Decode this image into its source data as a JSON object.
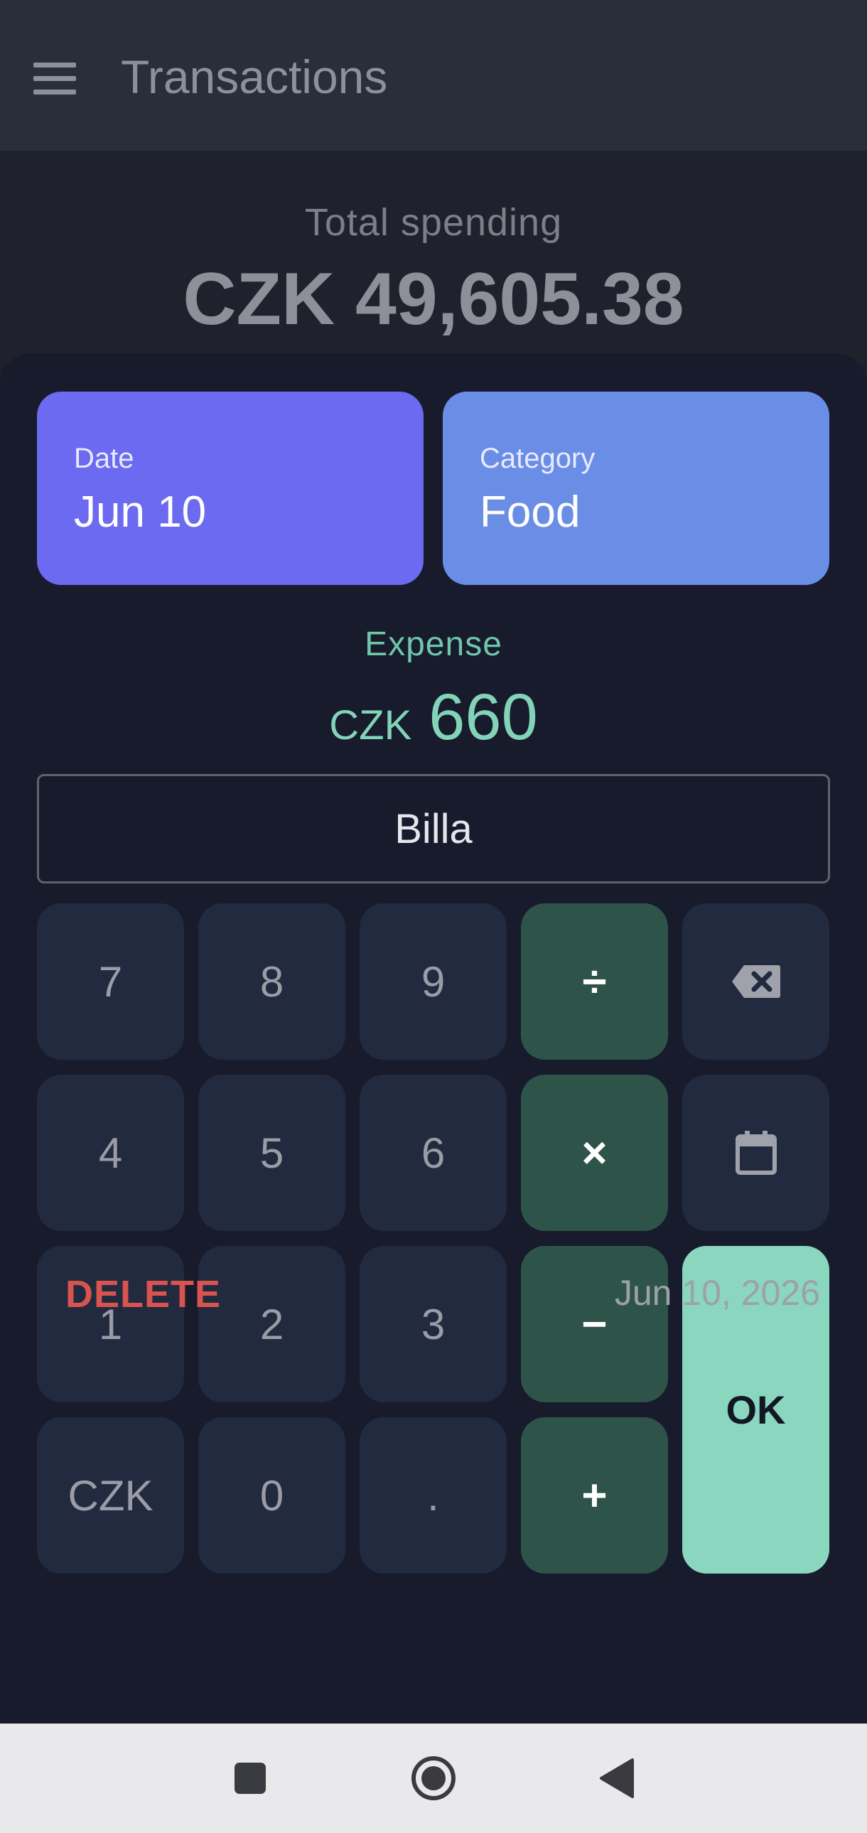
{
  "appbar": {
    "title": "Transactions",
    "menu_icon": "menu-icon"
  },
  "summary": {
    "label": "Total spending",
    "amount": "CZK 49,605.38"
  },
  "sheet": {
    "date_card": {
      "label": "Date",
      "value": "Jun 10"
    },
    "category_card": {
      "label": "Category",
      "value": "Food"
    },
    "type_label": "Expense",
    "amount": {
      "currency": "CZK",
      "value": "660"
    },
    "note": "Billa",
    "keypad": {
      "k7": "7",
      "k8": "8",
      "k9": "9",
      "divide": "÷",
      "backspace_icon": "backspace-icon",
      "k4": "4",
      "k5": "5",
      "k6": "6",
      "multiply": "×",
      "calendar_icon": "calendar-icon",
      "k1": "1",
      "k2": "2",
      "k3": "3",
      "minus": "−",
      "ok": "OK",
      "currency": "CZK",
      "k0": "0",
      "dot": ".",
      "plus": "+"
    },
    "delete_label": "DELETE",
    "date_text": "Jun 10, 2026"
  },
  "colors": {
    "date_card": "#6b6af0",
    "category_card": "#6a8de6",
    "operator_key": "#2e5449",
    "ok_key": "#8ad6bf",
    "expense_accent": "#82d3b8",
    "delete": "#d9534f"
  },
  "navbar": {
    "icons": [
      "recents-square-icon",
      "home-circle-icon",
      "back-triangle-icon"
    ]
  }
}
